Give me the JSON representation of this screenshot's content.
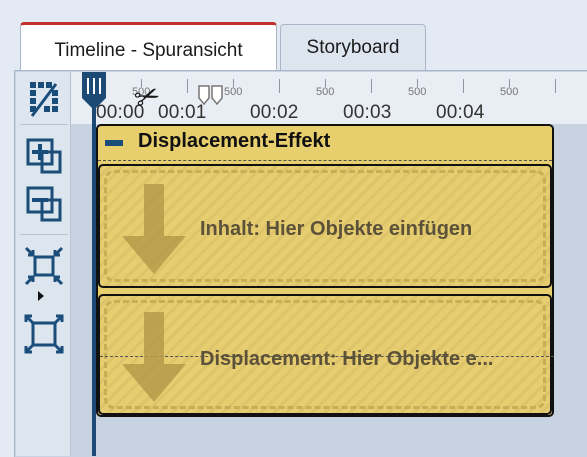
{
  "tabs": [
    {
      "label": "Timeline - Spuransicht",
      "active": true
    },
    {
      "label": "Storyboard",
      "active": false
    }
  ],
  "toolbar": {
    "tools": [
      {
        "icon": "percent-trim-icon"
      },
      {
        "icon": "add-track-icon"
      },
      {
        "icon": "remove-track-icon"
      },
      {
        "icon": "compress-view-icon"
      },
      {
        "icon": "expand-view-icon"
      }
    ]
  },
  "ruler": {
    "times": [
      "00:00",
      "00:01",
      "00:02",
      "00:03",
      "00:04"
    ],
    "half_marks": [
      "500",
      "500",
      "500",
      "500",
      "500"
    ]
  },
  "effect": {
    "title": "Displacement-Effekt",
    "slots": [
      {
        "label": "Inhalt: Hier Objekte einfügen"
      },
      {
        "label": "Displacement: Hier Objekte e..."
      }
    ]
  },
  "colors": {
    "accent_tab": "#c2302b",
    "effect_fill": "#e8cf6e",
    "icon_blue": "#1a4d7a"
  }
}
